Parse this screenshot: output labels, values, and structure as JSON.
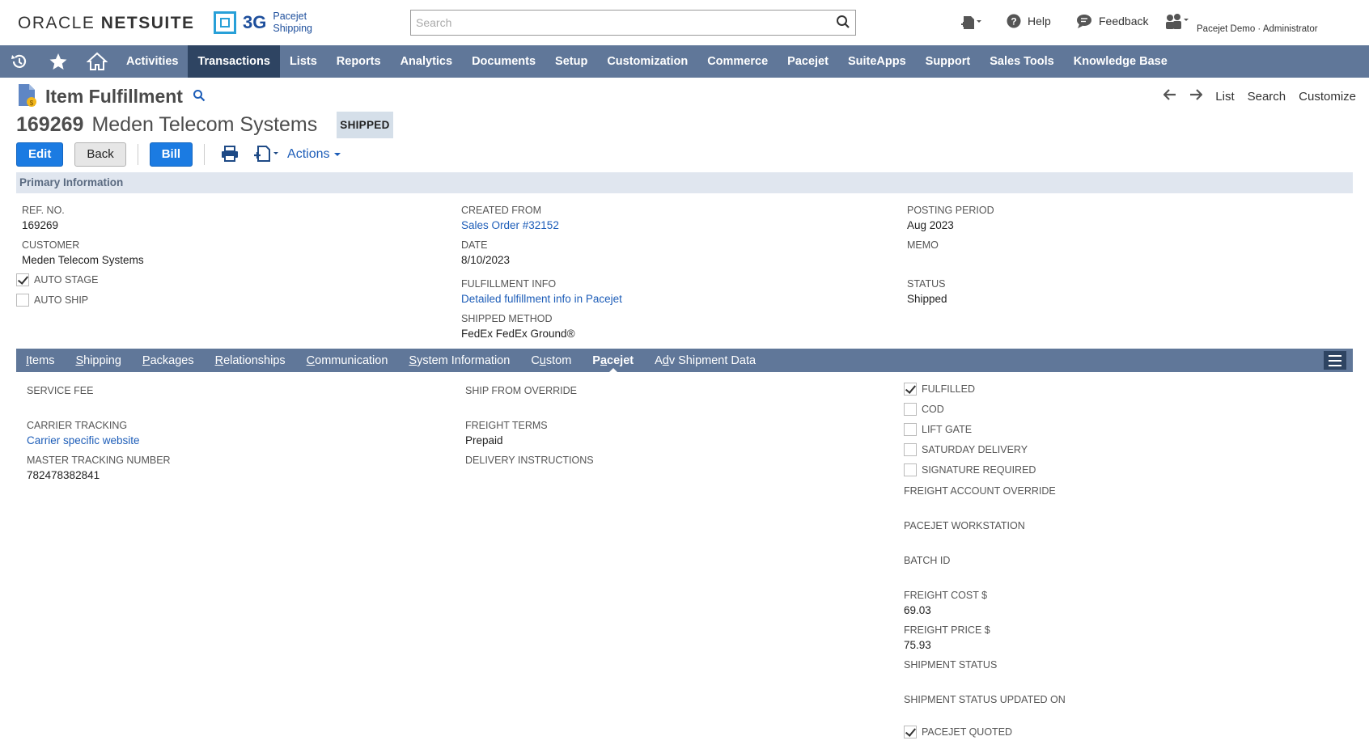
{
  "header": {
    "brand_oracle": "ORACLE",
    "brand_netsuite": "NETSUITE",
    "logo_3g": "3G",
    "logo_line1": "Pacejet",
    "logo_line2": "Shipping",
    "search_placeholder": "Search",
    "help": "Help",
    "feedback": "Feedback",
    "user": "Pacejet Demo · Administrator"
  },
  "nav": {
    "items": [
      "Activities",
      "Transactions",
      "Lists",
      "Reports",
      "Analytics",
      "Documents",
      "Setup",
      "Customization",
      "Commerce",
      "Pacejet",
      "SuiteApps",
      "Support",
      "Sales Tools",
      "Knowledge Base"
    ],
    "active": "Transactions"
  },
  "page": {
    "title": "Item Fulfillment",
    "record_number": "169269",
    "record_name": "Meden Telecom Systems",
    "status_badge": "SHIPPED",
    "right_links": [
      "List",
      "Search",
      "Customize"
    ]
  },
  "buttons": {
    "edit": "Edit",
    "back": "Back",
    "bill": "Bill",
    "actions": "Actions"
  },
  "primary": {
    "section_title": "Primary Information",
    "ref_no_label": "REF. NO.",
    "ref_no": "169269",
    "customer_label": "CUSTOMER",
    "customer": "Meden Telecom Systems",
    "auto_stage": "AUTO STAGE",
    "auto_ship": "AUTO SHIP",
    "created_from_label": "CREATED FROM",
    "created_from": "Sales Order #32152",
    "date_label": "DATE",
    "date": "8/10/2023",
    "fulfillment_info_label": "FULFILLMENT INFO",
    "fulfillment_info": "Detailed fulfillment info in Pacejet",
    "shipped_method_label": "SHIPPED METHOD",
    "shipped_method": "FedEx FedEx Ground®",
    "posting_period_label": "POSTING PERIOD",
    "posting_period": "Aug 2023",
    "memo_label": "MEMO",
    "status_label": "STATUS",
    "status": "Shipped"
  },
  "subtabs": {
    "items": [
      {
        "pre": "",
        "u": "I",
        "post": "tems"
      },
      {
        "pre": "",
        "u": "S",
        "post": "hipping"
      },
      {
        "pre": "",
        "u": "P",
        "post": "ackages"
      },
      {
        "pre": "",
        "u": "R",
        "post": "elationships"
      },
      {
        "pre": "",
        "u": "C",
        "post": "ommunication"
      },
      {
        "pre": "",
        "u": "S",
        "post": "ystem Information"
      },
      {
        "pre": "C",
        "u": "u",
        "post": "stom"
      },
      {
        "pre": "P",
        "u": "a",
        "post": "cejet"
      },
      {
        "pre": "A",
        "u": "d",
        "post": "v Shipment Data"
      }
    ],
    "active_index": 7
  },
  "pacejet": {
    "service_fee_label": "SERVICE FEE",
    "carrier_tracking_label": "CARRIER TRACKING",
    "carrier_tracking": "Carrier specific website",
    "master_tracking_label": "MASTER TRACKING NUMBER",
    "master_tracking": "782478382841",
    "ship_from_override_label": "SHIP FROM OVERRIDE",
    "freight_terms_label": "FREIGHT TERMS",
    "freight_terms": "Prepaid",
    "delivery_instructions_label": "DELIVERY INSTRUCTIONS",
    "checkboxes": [
      {
        "label": "FULFILLED",
        "checked": true
      },
      {
        "label": "COD",
        "checked": false
      },
      {
        "label": "LIFT GATE",
        "checked": false
      },
      {
        "label": "SATURDAY DELIVERY",
        "checked": false
      },
      {
        "label": "SIGNATURE REQUIRED",
        "checked": false
      }
    ],
    "freight_account_override_label": "FREIGHT ACCOUNT OVERRIDE",
    "workstation_label": "PACEJET WORKSTATION",
    "batch_id_label": "BATCH ID",
    "freight_cost_label": "FREIGHT COST $",
    "freight_cost": "69.03",
    "freight_price_label": "FREIGHT PRICE $",
    "freight_price": "75.93",
    "shipment_status_label": "SHIPMENT STATUS",
    "shipment_status_updated_label": "SHIPMENT STATUS UPDATED ON",
    "pacejet_quoted": "PACEJET QUOTED"
  }
}
